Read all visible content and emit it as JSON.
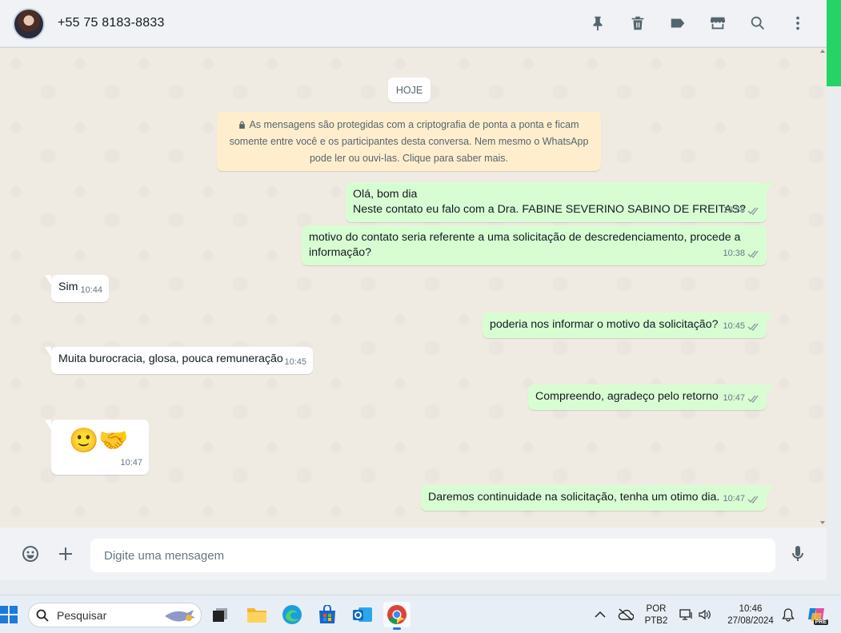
{
  "header": {
    "contact_name": "+55 75 8183-8833",
    "icons": [
      "pin-icon",
      "delete-icon",
      "label-icon",
      "store-icon",
      "search-icon",
      "menu-icon"
    ]
  },
  "chat": {
    "date_chip": "HOJE",
    "encryption_notice": {
      "line1": "As mensagens são protegidas com a criptografia de ponta a ponta e ficam",
      "line2": "somente entre você e os participantes desta conversa. Nem mesmo o WhatsApp",
      "line3": "pode ler ou ouvi-las. Clique para saber mais."
    },
    "messages": [
      {
        "direction": "out",
        "line1": "Olá, bom dia",
        "line2": "Neste contato eu falo com a Dra. FABINE SEVERINO SABINO DE FREITAS?",
        "time": "10:38"
      },
      {
        "direction": "out",
        "line1": "motivo do contato seria referente a uma solicitação de descredenciamento, procede a",
        "line2": "informação?",
        "time": "10:38"
      },
      {
        "direction": "in",
        "text": "Sim",
        "time": "10:44"
      },
      {
        "direction": "out",
        "text": "poderia nos informar o motivo da solicitação?",
        "time": "10:45"
      },
      {
        "direction": "in",
        "text": "Muita burocracia, glosa, pouca remuneração",
        "time": "10:45"
      },
      {
        "direction": "out",
        "text": "Compreendo, agradeço pelo retorno",
        "time": "10:47"
      },
      {
        "direction": "in",
        "text": "🙂🤝",
        "time": "10:47"
      },
      {
        "direction": "out",
        "text": "Daremos continuidade na solicitação, tenha um otimo dia.",
        "time": "10:47"
      }
    ]
  },
  "composer": {
    "placeholder": "Digite uma mensagem"
  },
  "taskbar": {
    "search_placeholder": "Pesquisar",
    "lang_line1": "POR",
    "lang_line2": "PTB2",
    "time": "10:46",
    "date": "27/08/2024",
    "copilot_badge": "PRE"
  },
  "colors": {
    "outgoing_bubble": "#d9fdd3",
    "incoming_bubble": "#ffffff",
    "chat_background": "#efeae2",
    "notice_background": "#ffeecd",
    "accent_green": "#25d366"
  }
}
